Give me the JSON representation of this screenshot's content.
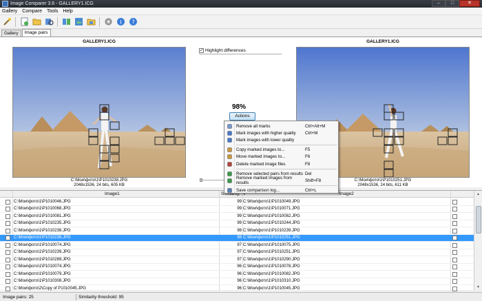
{
  "window": {
    "title": "Image Comparer 3.6 - GALLERY1.ICG",
    "minimize": "–",
    "maximize": "□",
    "close": "✕"
  },
  "menu": [
    "Gallery",
    "Compare",
    "Tools",
    "Help"
  ],
  "toolbar_icons": [
    "wand-icon",
    "new-icon",
    "open-folder-icon",
    "search-images-icon",
    "compare-icon",
    "compare-gallery-icon",
    "folder-compare-icon",
    "settings-icon",
    "info-icon",
    "help-icon"
  ],
  "tabs": [
    {
      "label": "Gallery",
      "active": false
    },
    {
      "label": "Image pairs",
      "active": true
    }
  ],
  "left_image": {
    "title": "GALLERY1.ICG",
    "path": "C:\\Мои\\фото\\1\\P1010238.JPG",
    "info": "2048x1536, 24 bits, 605 KB"
  },
  "right_image": {
    "title": "GALLERY1.ICG",
    "path": "C:\\Мои\\фото\\1\\P1010251.JPG",
    "info": "2048x1536, 24 bits, 611 KB"
  },
  "highlight": {
    "label": "Highlight differences",
    "checked": true
  },
  "similarity_pct": "98%",
  "actions_button": "Actions",
  "context_menu": [
    {
      "label": "Remove all marks",
      "key": "Ctrl+Alt+M",
      "icon": "remove-marks-icon",
      "color": "#7a98c9"
    },
    {
      "label": "Mark images with higher quality",
      "key": "Ctrl+M",
      "icon": "mark-higher-icon",
      "color": "#4a7ac8"
    },
    {
      "label": "Mark images with lower quality",
      "key": "",
      "icon": "mark-lower-icon",
      "color": "#4a7ac8"
    },
    {
      "label": "Copy marked images to...",
      "key": "F5",
      "icon": "copy-icon",
      "color": "#c99a3d",
      "sep_before": true
    },
    {
      "label": "Move marked images to...",
      "key": "F6",
      "icon": "move-icon",
      "color": "#c99a3d"
    },
    {
      "label": "Delete marked image files",
      "key": "F8",
      "icon": "delete-icon",
      "color": "#b5453a"
    },
    {
      "label": "Remove selected pairs from results",
      "key": "Del",
      "icon": "remove-pairs-icon",
      "color": "#3c9a4a",
      "sep_before": true
    },
    {
      "label": "Remove marked images from results",
      "key": "Shift+F8",
      "icon": "remove-marked-icon",
      "color": "#3c9a4a"
    },
    {
      "label": "Save comparison log...",
      "key": "Ctrl+L",
      "icon": "save-log-icon",
      "color": "#5a7fb0",
      "sep_before": true
    }
  ],
  "grid": {
    "headers": {
      "image1": "Image1",
      "similarity": "Similarity, %",
      "image2": "Image2"
    },
    "rows": [
      {
        "p1": "C:\\Мои\\фото\\1\\P1010046.JPG",
        "sim": "99",
        "p2": "C:\\Мои\\фото\\1\\P1010049.JPG",
        "selected": false
      },
      {
        "p1": "C:\\Мои\\фото\\1\\P1010068.JPG",
        "sim": "99",
        "p2": "C:\\Мои\\фото\\1\\P1010071.JPG",
        "selected": false
      },
      {
        "p1": "C:\\Мои\\фото\\1\\P1010081.JPG",
        "sim": "99",
        "p2": "C:\\Мои\\фото\\1\\P1010082.JPG",
        "selected": false
      },
      {
        "p1": "C:\\Мои\\фото\\1\\P1010235.JPG",
        "sim": "99",
        "p2": "C:\\Мои\\фото\\1\\P1010244.JPG",
        "selected": false
      },
      {
        "p1": "C:\\Мои\\фото\\1\\P1010238.JPG",
        "sim": "98",
        "p2": "C:\\Мои\\фото\\1\\P1010239.JPG",
        "selected": false
      },
      {
        "p1": "C:\\Мои\\фото\\1\\P1010238.JPG",
        "sim": "98",
        "p2": "C:\\Мои\\фото\\1\\P1010251.JPG",
        "selected": true
      },
      {
        "p1": "C:\\Мои\\фото\\1\\P1010074.JPG",
        "sim": "97",
        "p2": "C:\\Мои\\фото\\1\\P1010075.JPG",
        "selected": false
      },
      {
        "p1": "C:\\Мои\\фото\\1\\P1010239.JPG",
        "sim": "97",
        "p2": "C:\\Мои\\фото\\1\\P1010251.JPG",
        "selected": false
      },
      {
        "p1": "C:\\Мои\\фото\\1\\P1010289.JPG",
        "sim": "97",
        "p2": "C:\\Мои\\фото\\1\\P1010290.JPG",
        "selected": false
      },
      {
        "p1": "C:\\Мои\\фото\\1\\P1010074.JPG",
        "sim": "96",
        "p2": "C:\\Мои\\фото\\1\\P1010078.JPG",
        "selected": false
      },
      {
        "p1": "C:\\Мои\\фото\\1\\P1010079.JPG",
        "sim": "96",
        "p2": "C:\\Мои\\фото\\1\\P1010082.JPG",
        "selected": false
      },
      {
        "p1": "C:\\Мои\\фото\\1\\P1010308.JPG",
        "sim": "96",
        "p2": "C:\\Мои\\фото\\1\\P1010310.JPG",
        "selected": false
      },
      {
        "p1": "C:\\Мои\\фото\\2\\Copy of P1010045.JPG",
        "sim": "96",
        "p2": "C:\\Мои\\фото\\1\\P1010045.JPG",
        "selected": false
      }
    ]
  },
  "status": {
    "pairs": "Image pairs: 25",
    "threshold": "Similarity threshold: 95"
  }
}
